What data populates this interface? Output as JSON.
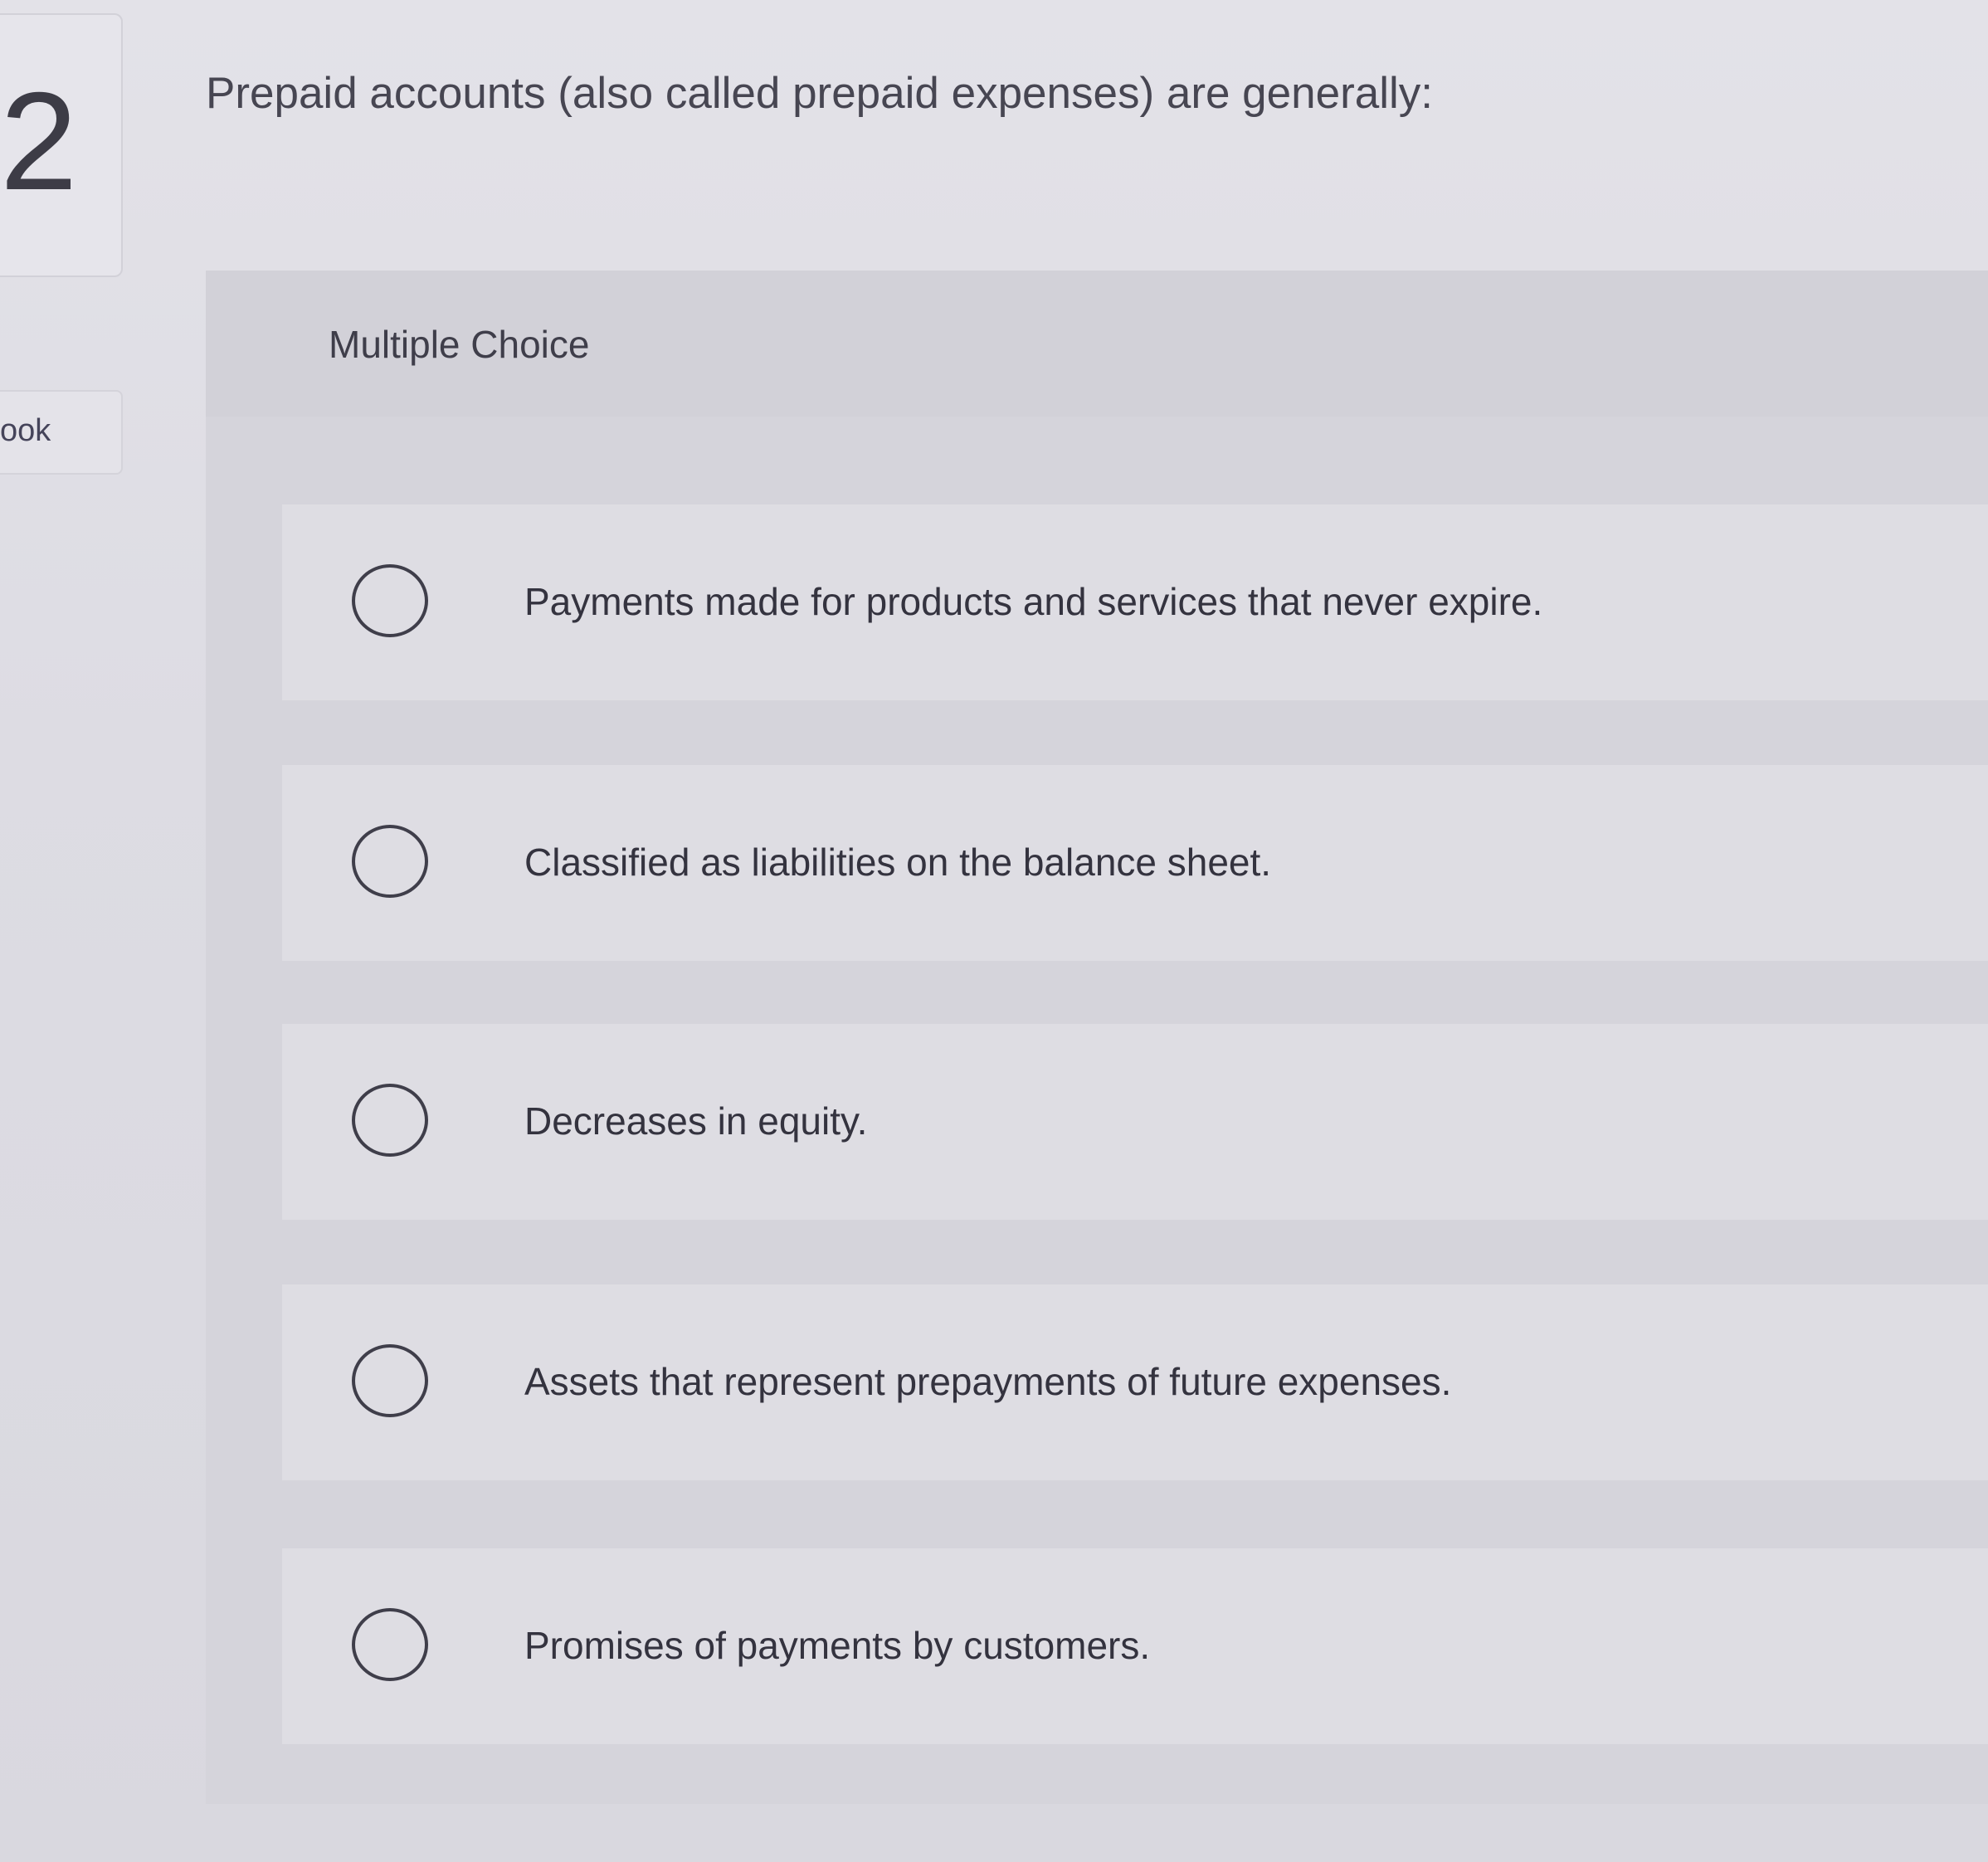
{
  "question": {
    "number": "2",
    "text": "Prepaid accounts (also called prepaid expenses) are generally:"
  },
  "sidebar": {
    "tab_label": "ook"
  },
  "answer_panel": {
    "type_label": "Multiple Choice",
    "options": [
      {
        "label": "Payments made for products and services that never expire.",
        "selected": false
      },
      {
        "label": "Classified as liabilities on the balance sheet.",
        "selected": false
      },
      {
        "label": "Decreases in equity.",
        "selected": false
      },
      {
        "label": "Assets that represent prepayments of future expenses.",
        "selected": false
      },
      {
        "label": "Promises of payments by customers.",
        "selected": false
      }
    ]
  }
}
